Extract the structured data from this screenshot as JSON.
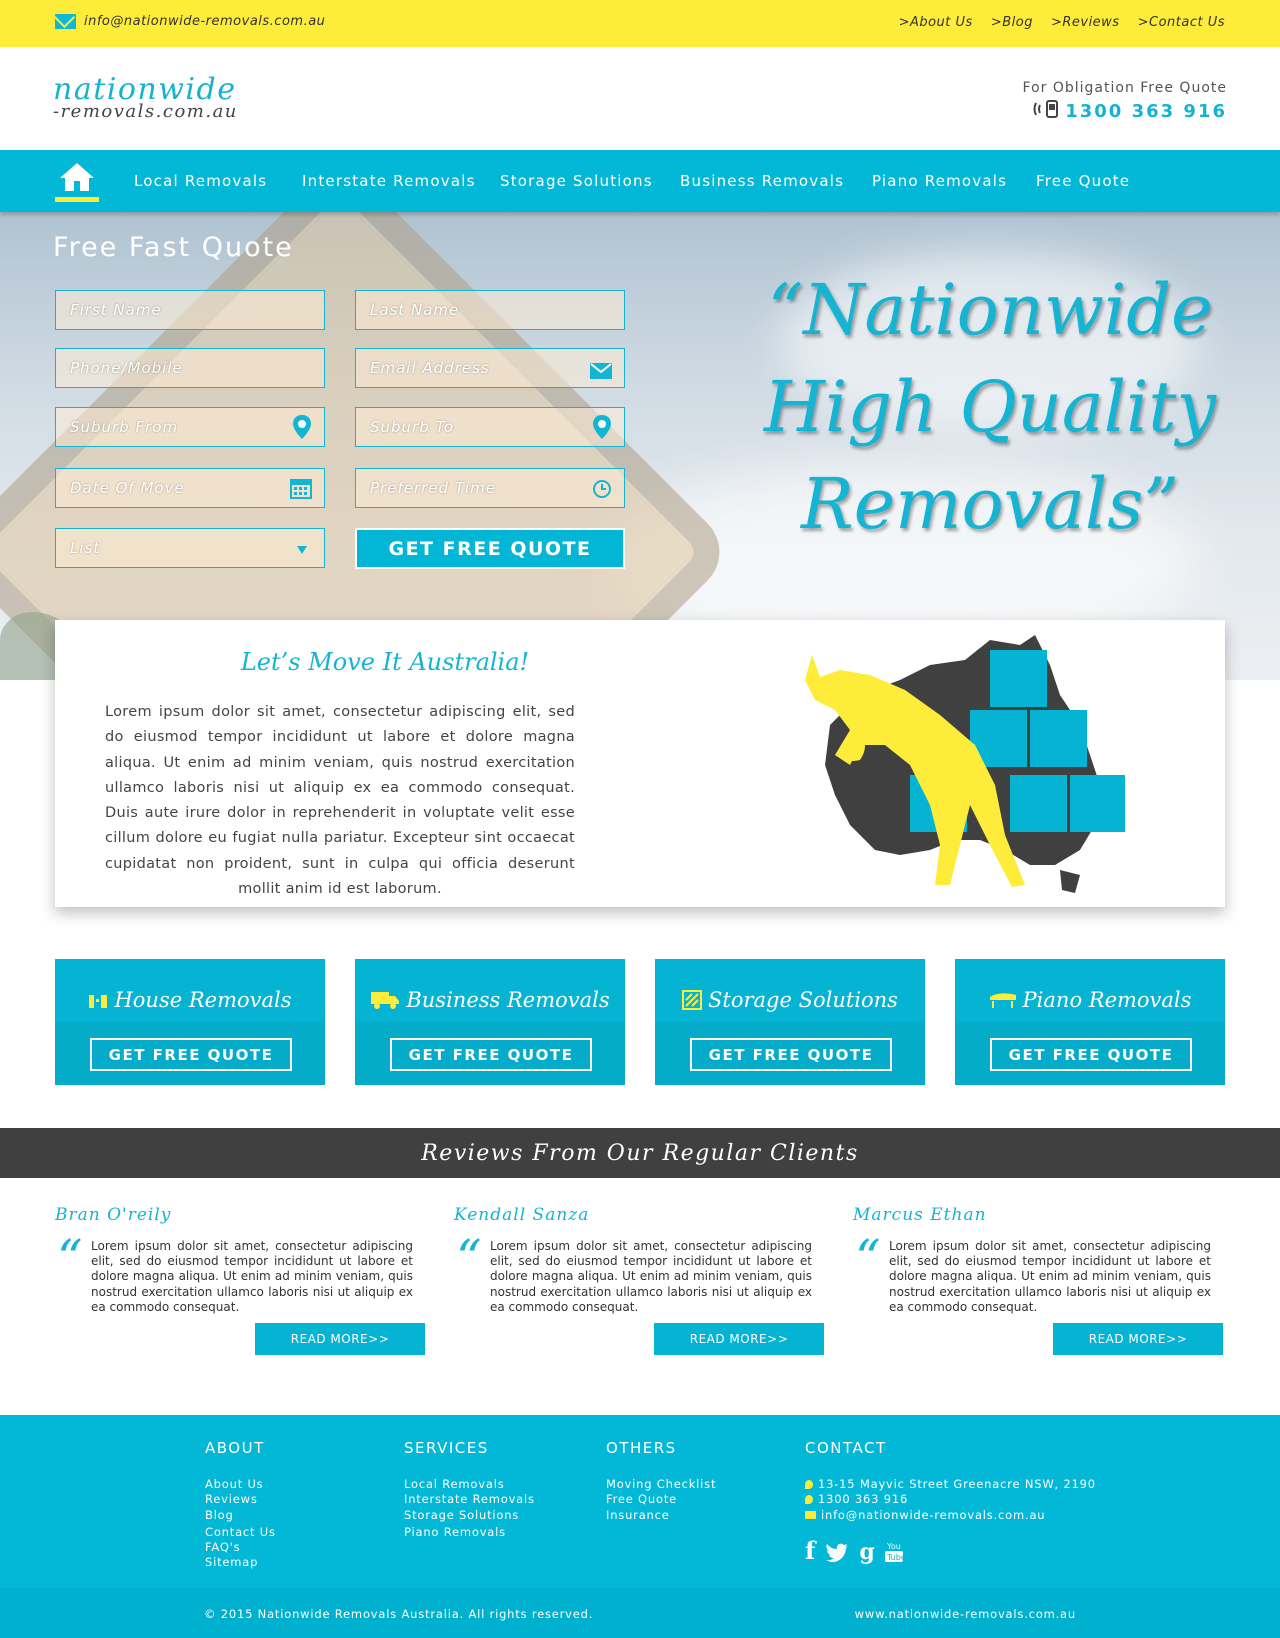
{
  "topbar": {
    "email": "info@nationwide-removals.com.au",
    "links": [
      ">About Us",
      ">Blog",
      ">Reviews",
      ">Contact Us"
    ]
  },
  "header": {
    "logo_line1": "nationwide",
    "logo_line2": "-removals.com.au",
    "quote_label": "For Obligation Free Quote",
    "phone": "1300 363 916"
  },
  "nav": {
    "items": [
      "Local Removals",
      "Interstate Removals",
      "Storage Solutions",
      "Business Removals",
      "Piano Removals",
      "Free Quote"
    ]
  },
  "quote_form": {
    "title": "Free Fast Quote",
    "first_name": "First Name",
    "last_name": "Last Name",
    "phone": "Phone/Mobile",
    "email": "Email Address",
    "suburb_from": "Suburb From",
    "suburb_to": "Suburb To",
    "date": "Date Of Move",
    "time": "Preferred Time",
    "list": "List",
    "submit": "GET FREE QUOTE"
  },
  "slogan": {
    "line1": "“Nationwide",
    "line2": "High Quality",
    "line3": "Removals”"
  },
  "about": {
    "title": "Let’s Move It Australia!",
    "text": "Lorem ipsum dolor sit amet, consectetur adipiscing elit, sed do eiusmod tempor incididunt ut labore et dolore magna aliqua. Ut enim ad minim veniam, quis nostrud exercitation ullamco laboris nisi ut aliquip ex ea commodo consequat. Duis aute irure dolor in reprehenderit in voluptate velit esse cillum dolore eu fugiat nulla pariatur. Excepteur sint occaecat cupidatat non proident, sunt in culpa qui officia deserunt mollit anim id est laborum."
  },
  "services": [
    {
      "title": "House Removals",
      "button": "GET FREE QUOTE"
    },
    {
      "title": "Business Removals",
      "button": "GET FREE QUOTE"
    },
    {
      "title": "Storage Solutions",
      "button": "GET FREE QUOTE"
    },
    {
      "title": "Piano Removals",
      "button": "GET FREE QUOTE"
    }
  ],
  "reviews": {
    "heading": "Reviews From Our Regular Clients",
    "items": [
      {
        "name": "Bran O'reily",
        "text": "Lorem ipsum dolor sit amet, consectetur adipiscing elit, sed do eiusmod tempor incididunt ut labore et dolore magna aliqua. Ut enim ad minim veniam, quis nostrud exercitation ullamco laboris nisi ut aliquip ex ea commodo consequat.",
        "button": "READ MORE>>"
      },
      {
        "name": "Kendall Sanza",
        "text": "Lorem ipsum dolor sit amet, consectetur adipiscing elit, sed do eiusmod tempor incididunt ut labore et dolore magna aliqua. Ut enim ad minim veniam, quis nostrud exercitation ullamco laboris nisi ut aliquip ex ea commodo consequat.",
        "button": "READ MORE>>"
      },
      {
        "name": "Marcus Ethan",
        "text": "Lorem ipsum dolor sit amet, consectetur adipiscing elit, sed do eiusmod tempor incididunt ut labore et dolore magna aliqua. Ut enim ad minim veniam, quis nostrud exercitation ullamco laboris nisi ut aliquip ex ea commodo consequat.",
        "button": "READ MORE>>"
      }
    ]
  },
  "footer": {
    "about": {
      "heading": "ABOUT",
      "links": [
        "About Us",
        "Reviews",
        "Blog",
        "Contact Us",
        "FAQ's",
        "Sitemap"
      ]
    },
    "services": {
      "heading": "SERVICES",
      "links": [
        "Local Removals",
        "Interstate Removals",
        "Storage Solutions",
        "Piano Removals"
      ]
    },
    "others": {
      "heading": "OTHERS",
      "links": [
        "Moving Checklist",
        "Free Quote",
        "Insurance"
      ]
    },
    "contact": {
      "heading": "CONTACT",
      "address": "13-15 Mayvic Street Greenacre NSW, 2190",
      "phone": "1300 363 916",
      "email": "info@nationwide-removals.com.au"
    },
    "social": [
      "facebook-icon",
      "twitter-icon",
      "google-plus-icon",
      "youtube-icon"
    ],
    "copyright": "© 2015 Nationwide Removals Australia. All rights reserved.",
    "site": "www.nationwide-removals.com.au"
  },
  "colors": {
    "accent": "#02b8d6",
    "yellow": "#fdec3a",
    "dark": "#404040"
  }
}
